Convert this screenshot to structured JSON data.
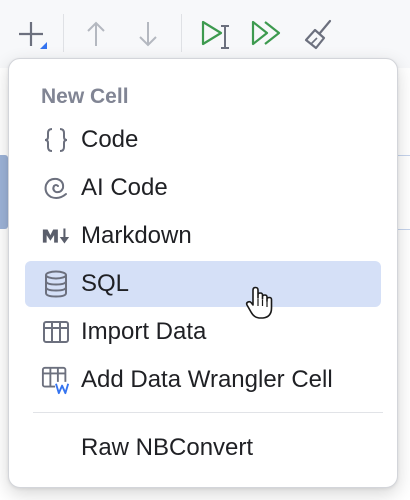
{
  "toolbar": {
    "buttons": [
      {
        "name": "add-cell-button",
        "icon": "plus-with-dropdown-icon"
      },
      {
        "name": "move-cell-up-button",
        "icon": "arrow-up-icon"
      },
      {
        "name": "move-cell-down-button",
        "icon": "arrow-down-icon"
      },
      {
        "name": "run-cell-button",
        "icon": "run-cursor-icon"
      },
      {
        "name": "run-all-button",
        "icon": "run-all-icon"
      },
      {
        "name": "clear-outputs-button",
        "icon": "broom-icon"
      }
    ]
  },
  "menu": {
    "header": "New Cell",
    "items": [
      {
        "label": "Code",
        "icon": "braces-icon"
      },
      {
        "label": "AI Code",
        "icon": "ai-spiral-icon"
      },
      {
        "label": "Markdown",
        "icon": "markdown-icon"
      },
      {
        "label": "SQL",
        "icon": "database-icon",
        "selected": true
      },
      {
        "label": "Import Data",
        "icon": "table-icon"
      },
      {
        "label": "Add Data Wrangler Cell",
        "icon": "table-w-icon"
      }
    ],
    "extra_item": {
      "label": "Raw NBConvert"
    }
  },
  "colors": {
    "selection": "#d5e0f7",
    "run_green": "#3d9a4f",
    "icon_gray": "#6c707e",
    "disabled_gray": "#b4b8c0",
    "accent_blue": "#3574f0"
  }
}
